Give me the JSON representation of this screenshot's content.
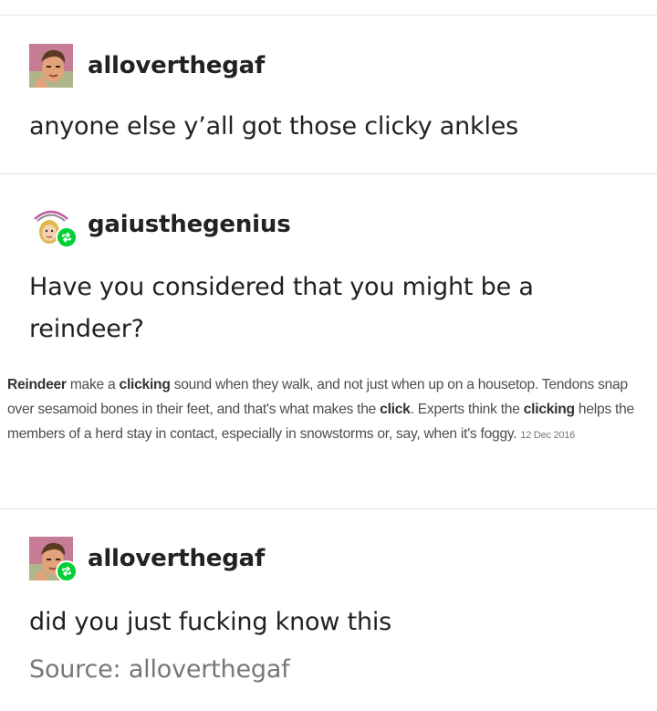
{
  "posts": [
    {
      "username": "alloverthegaf",
      "avatar_icon": "avatar-man-icon",
      "reblog": false,
      "text": "anyone else y’all got those clicky ankles"
    },
    {
      "username": "gaiusthegenius",
      "avatar_icon": "avatar-cartoon-woman-icon",
      "reblog": true,
      "text": "Have you considered that you might be a reindeer?",
      "quote": {
        "segments": [
          {
            "text": "Reindeer",
            "bold": true
          },
          {
            "text": " make a ",
            "bold": false
          },
          {
            "text": "clicking",
            "bold": true
          },
          {
            "text": " sound when they walk, and not just when up on a housetop. Tendons snap over sesamoid bones in their feet, and that's what makes the ",
            "bold": false
          },
          {
            "text": "click",
            "bold": true
          },
          {
            "text": ". Experts think the ",
            "bold": false
          },
          {
            "text": "clicking",
            "bold": true
          },
          {
            "text": " helps the members of a herd stay in contact, especially in snowstorms or, say, when it's foggy.",
            "bold": false
          }
        ],
        "date": "12 Dec 2016"
      }
    },
    {
      "username": "alloverthegaf",
      "avatar_icon": "avatar-man-icon",
      "reblog": true,
      "text": "did you just fucking know this"
    }
  ],
  "source": "Source: alloverthegaf",
  "colors": {
    "text": "#222222",
    "muted": "#777777",
    "reblog_badge": "#00cf35",
    "divider": "#e3e3e3"
  }
}
